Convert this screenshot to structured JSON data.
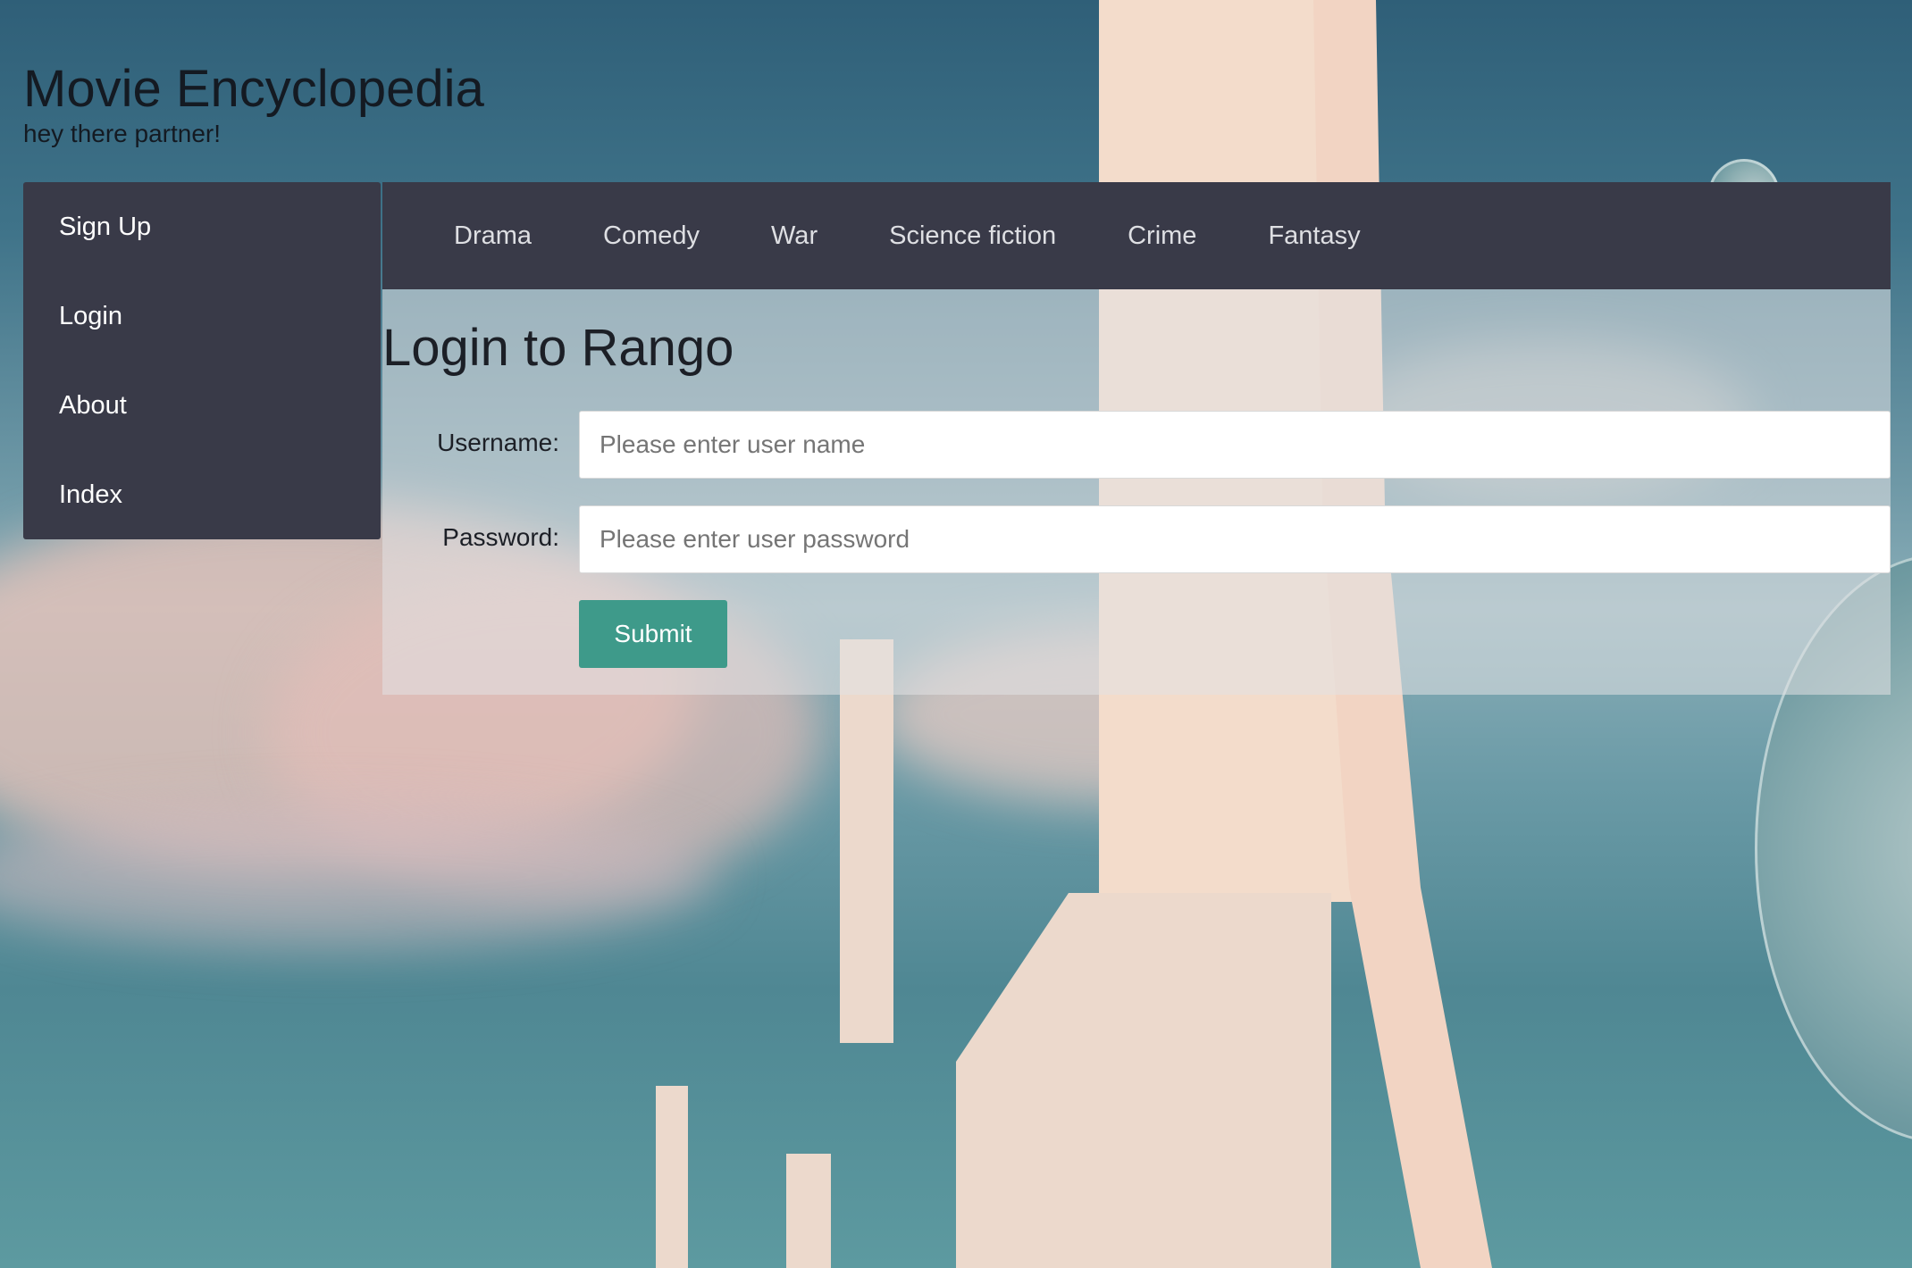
{
  "header": {
    "title": "Movie Encyclopedia",
    "subtitle": "hey there partner!"
  },
  "sidebar": {
    "items": [
      {
        "label": "Sign Up"
      },
      {
        "label": "Login"
      },
      {
        "label": "About"
      },
      {
        "label": "Index"
      }
    ]
  },
  "topnav": {
    "items": [
      {
        "label": "Drama"
      },
      {
        "label": "Comedy"
      },
      {
        "label": "War"
      },
      {
        "label": "Science fiction"
      },
      {
        "label": "Crime"
      },
      {
        "label": "Fantasy"
      }
    ]
  },
  "login": {
    "heading": "Login to Rango",
    "username_label": "Username:",
    "username_placeholder": "Please enter user name",
    "password_label": "Password:",
    "password_placeholder": "Please enter user password",
    "submit_label": "Submit"
  },
  "colors": {
    "nav_background": "#393a48",
    "submit_button": "#3e9a8a",
    "sky": "#4f8793"
  }
}
